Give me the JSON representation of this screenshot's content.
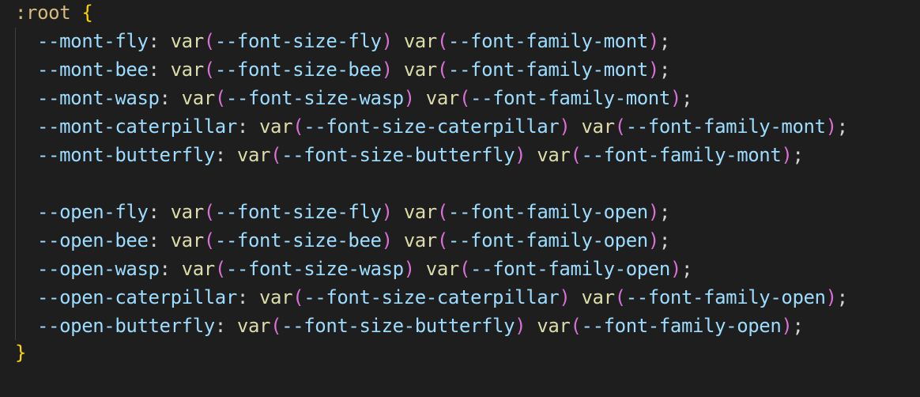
{
  "editor": {
    "language": "css",
    "theme_colors": {
      "background": "#1e1e1e",
      "selector": "#d7ba7d",
      "brace": "#ffd700",
      "property": "#9cdcfe",
      "function": "#dcdcaa",
      "paren": "#da70d6",
      "text": "#d4d4d4"
    },
    "selector": ":root",
    "open_brace": "{",
    "close_brace": "}",
    "declarations": [
      {
        "prop": "--mont-fly",
        "a": "--font-size-fly",
        "b": "--font-family-mont"
      },
      {
        "prop": "--mont-bee",
        "a": "--font-size-bee",
        "b": "--font-family-mont"
      },
      {
        "prop": "--mont-wasp",
        "a": "--font-size-wasp",
        "b": "--font-family-mont"
      },
      {
        "prop": "--mont-caterpillar",
        "a": "--font-size-caterpillar",
        "b": "--font-family-mont"
      },
      {
        "prop": "--mont-butterfly",
        "a": "--font-size-butterfly",
        "b": "--font-family-mont"
      },
      {
        "prop": "--open-fly",
        "a": "--font-size-fly",
        "b": "--font-family-open"
      },
      {
        "prop": "--open-bee",
        "a": "--font-size-bee",
        "b": "--font-family-open"
      },
      {
        "prop": "--open-wasp",
        "a": "--font-size-wasp",
        "b": "--font-family-open"
      },
      {
        "prop": "--open-caterpillar",
        "a": "--font-size-caterpillar",
        "b": "--font-family-open"
      },
      {
        "prop": "--open-butterfly",
        "a": "--font-size-butterfly",
        "b": "--font-family-open"
      }
    ],
    "fn_name": "var",
    "colon": ": ",
    "lparen": "(",
    "rparen": ")",
    "space": " ",
    "semicolon": ";"
  }
}
